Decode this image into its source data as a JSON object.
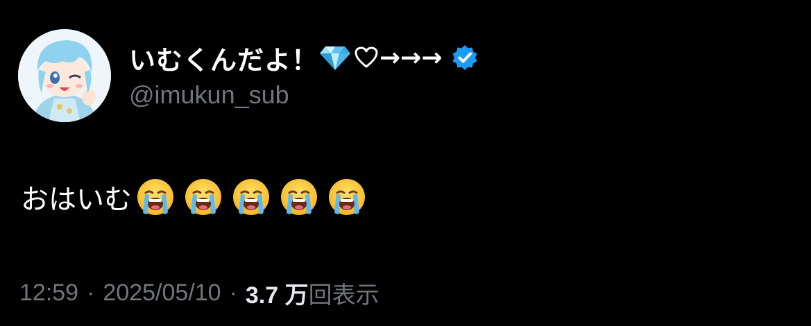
{
  "author": {
    "display_name": "いむくんだよ！",
    "name_arrows": "→→→",
    "handle": "@imukun_sub",
    "verified": true,
    "verified_color": "#1d9bf0",
    "name_icons": [
      "gem-icon",
      "heart-outline-icon",
      "verified-badge-icon"
    ]
  },
  "tweet": {
    "text": "おはいむ",
    "emojis": [
      "loudly-crying-face",
      "loudly-crying-face",
      "loudly-crying-face",
      "loudly-crying-face",
      "loudly-crying-face"
    ]
  },
  "meta": {
    "time": "12:59",
    "date": "2025/05/10",
    "separator": "·",
    "view_count": "3.7 万",
    "view_label": "回表示"
  },
  "colors": {
    "background": "#000000",
    "primary_text": "#ffffff",
    "secondary_text": "#71767b",
    "accent": "#1d9bf0"
  }
}
